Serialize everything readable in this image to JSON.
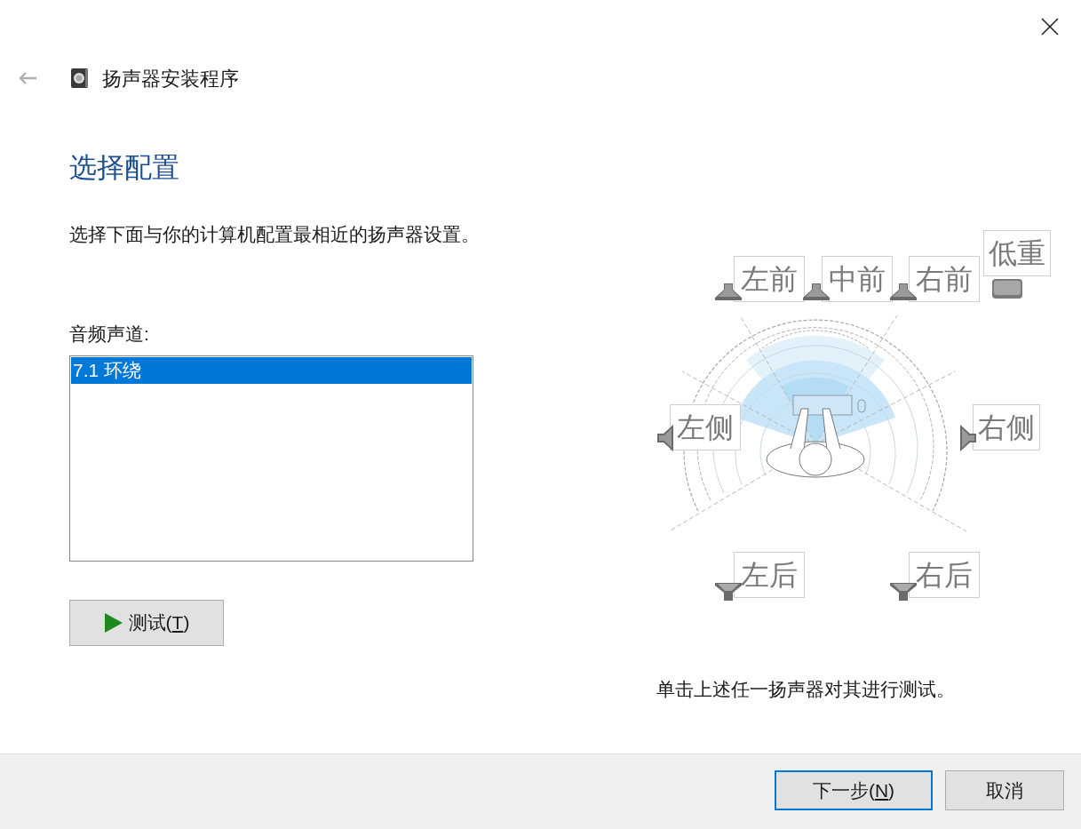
{
  "header": {
    "title": "扬声器安装程序"
  },
  "page_title": "选择配置",
  "instruction": "选择下面与你的计算机配置最相近的扬声器设置。",
  "channels_label": "音频声道:",
  "channels": [
    {
      "label": "7.1 环绕",
      "selected": true
    }
  ],
  "test_button": {
    "text": "测试(",
    "mnemonic": "T",
    "after": ")"
  },
  "speakers": [
    {
      "label": "左前",
      "kind": "front-left"
    },
    {
      "label": "中前",
      "kind": "front-center"
    },
    {
      "label": "右前",
      "kind": "front-right"
    },
    {
      "label": "低重",
      "kind": "subwoofer"
    },
    {
      "label": "左侧",
      "kind": "side-left"
    },
    {
      "label": "右侧",
      "kind": "side-right"
    },
    {
      "label": "左后",
      "kind": "rear-left"
    },
    {
      "label": "右后",
      "kind": "rear-right"
    }
  ],
  "hint": "单击上述任一扬声器对其进行测试。",
  "footer": {
    "buttons": [
      {
        "text": "下一步(",
        "mnemonic": "N",
        "after": ")",
        "default": true
      },
      {
        "text": "取消",
        "default": false
      }
    ]
  }
}
